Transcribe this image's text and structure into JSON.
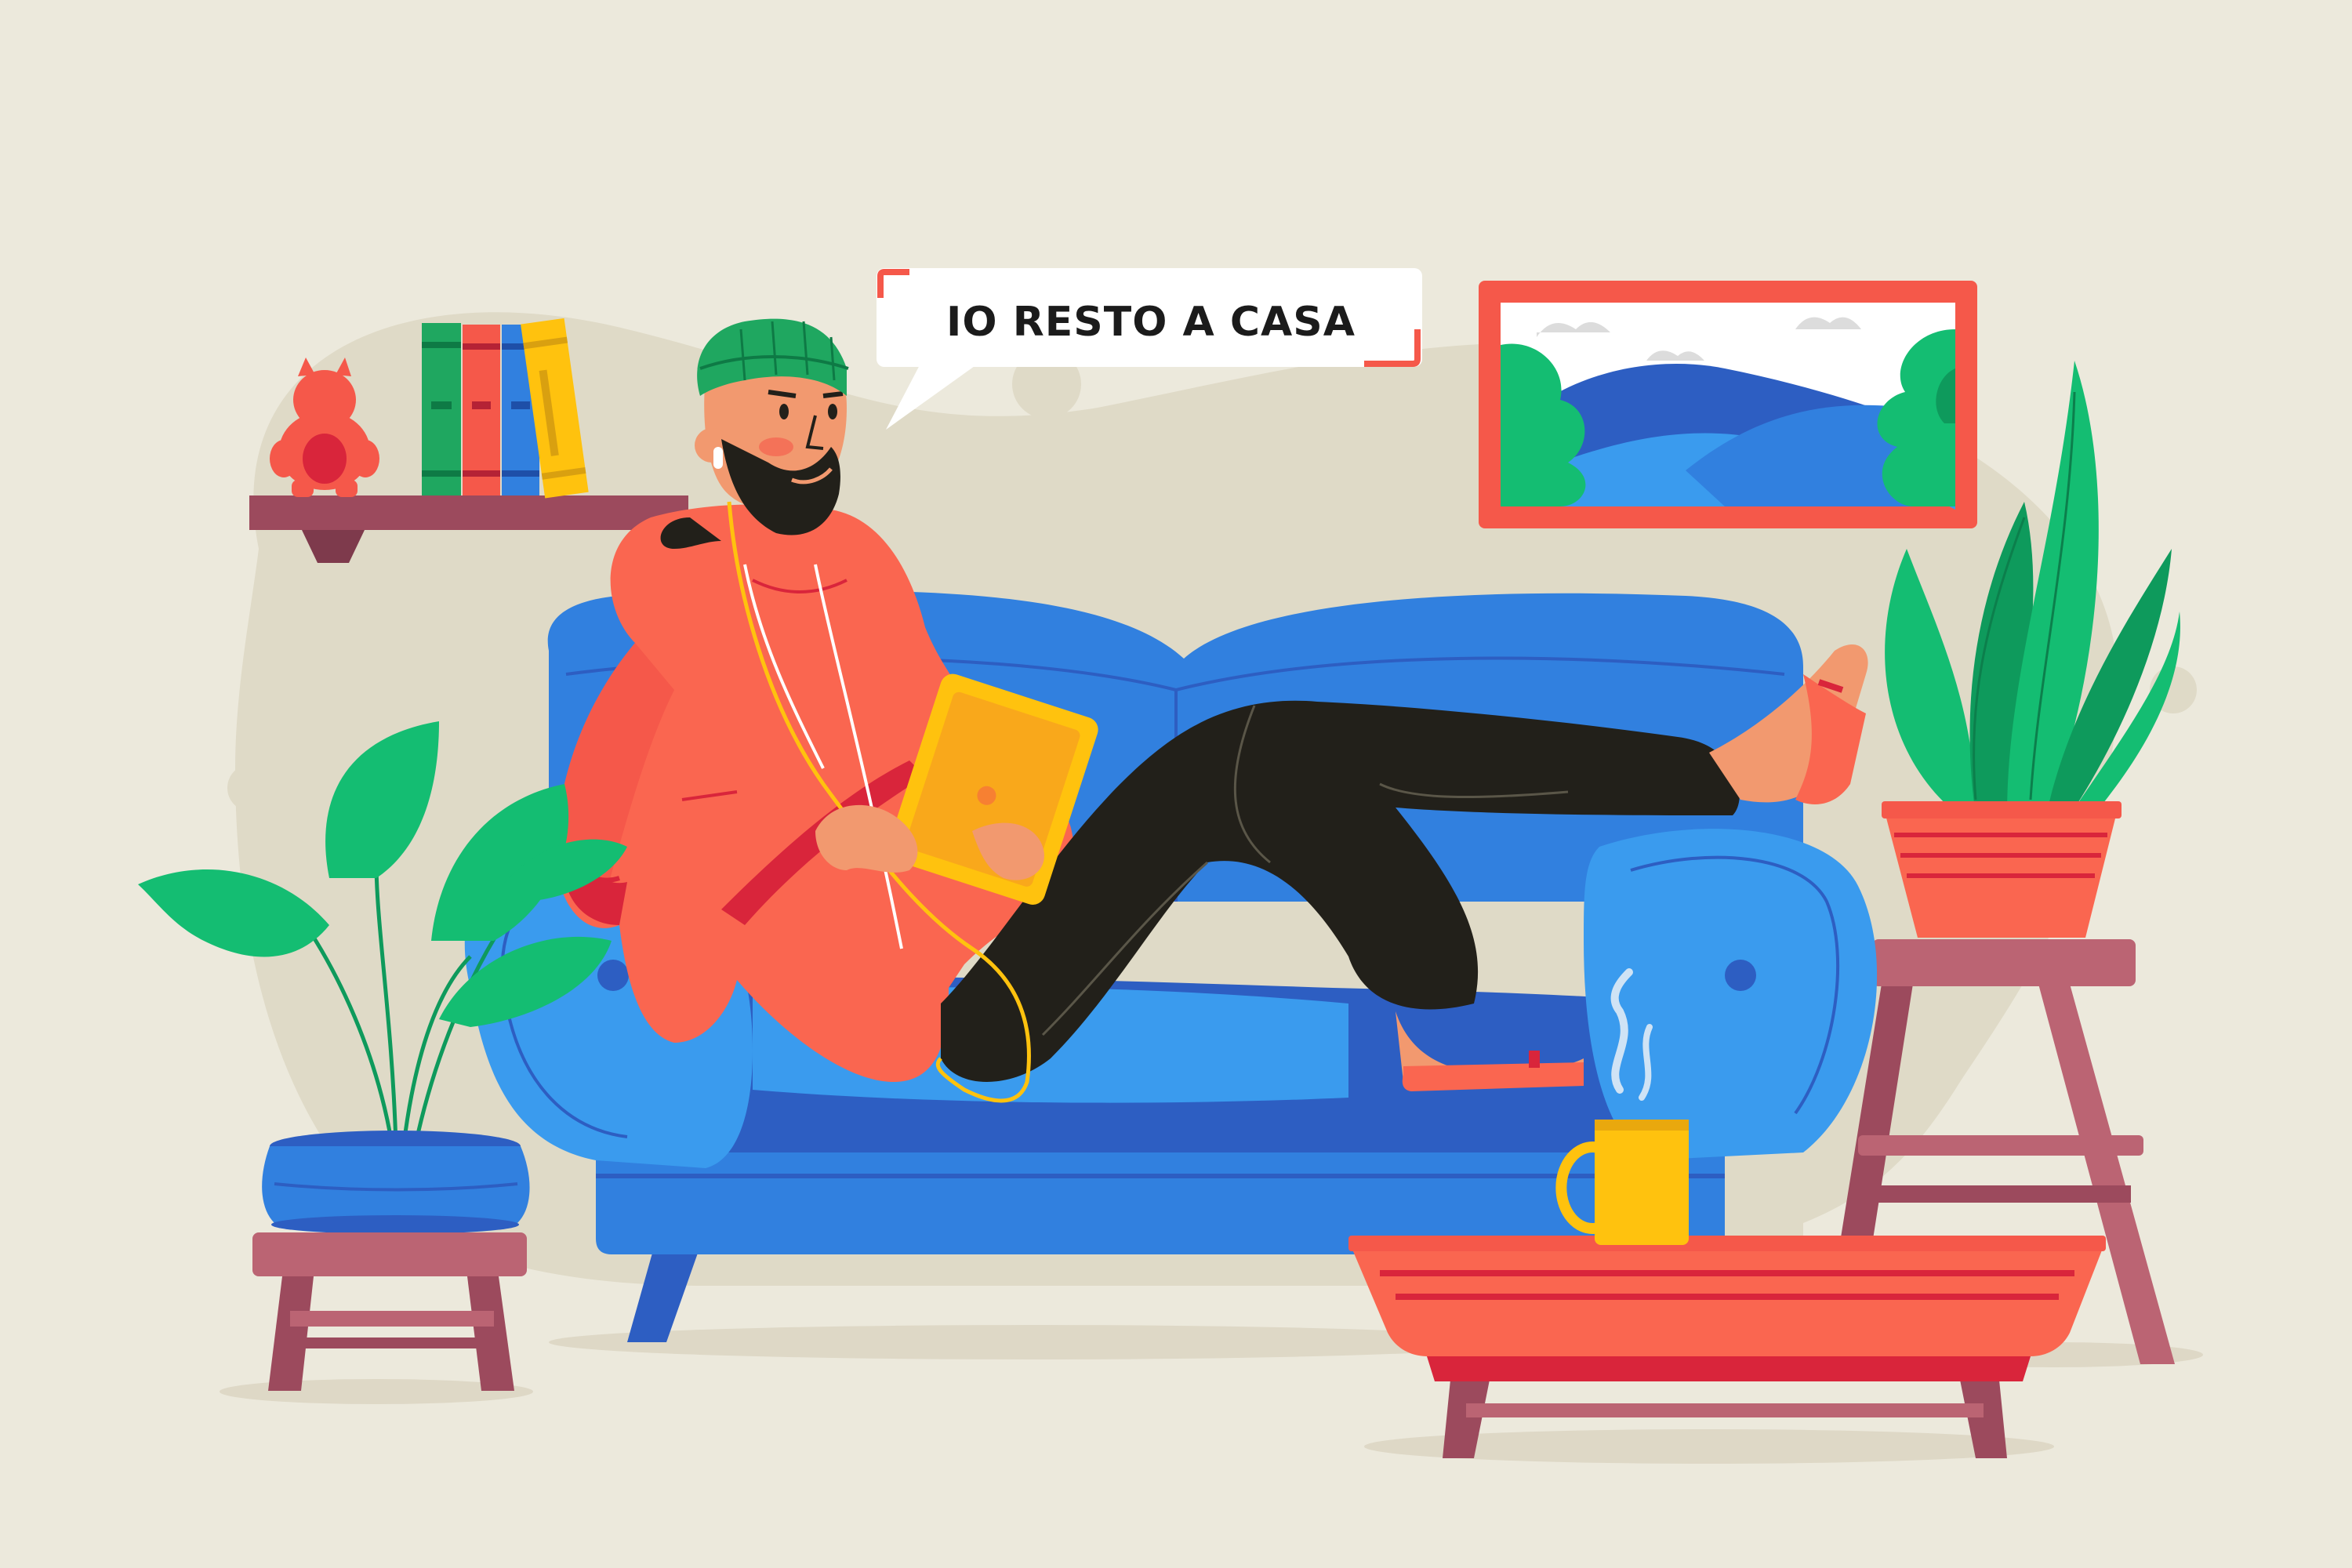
{
  "speech_bubble": {
    "text": "IO RESTO A CASA"
  },
  "colors": {
    "background": "#ECE9DC",
    "blob": "#DFDAC7",
    "sofa_light": "#3A9BEE",
    "sofa_mid": "#3180DF",
    "sofa_dark": "#2D5EC2",
    "hoodie": "#FA6650",
    "hoodie_dark": "#D9253B",
    "pants": "#22201A",
    "beanie": "#1FA760",
    "tablet": "#FFC20E",
    "skin": "#F2996F",
    "furniture": "#BB6473",
    "furniture_dark": "#9C4A5D",
    "plant_green": "#14BD72",
    "plant_dark": "#0E9A5C",
    "frame": "#F5584A"
  }
}
